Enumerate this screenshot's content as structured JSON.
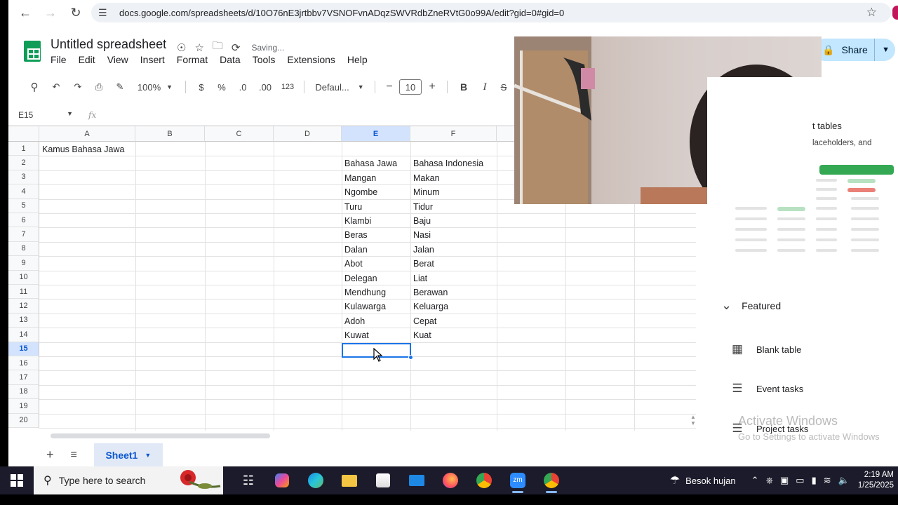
{
  "browser": {
    "url": "docs.google.com/spreadsheets/d/10O76nE3jrtbbv7VSNOFvnADqzSWVRdbZneRVtG0o99A/edit?gid=0#gid=0"
  },
  "sheets": {
    "title": "Untitled spreadsheet",
    "status": "Saving...",
    "menu": [
      "File",
      "Edit",
      "View",
      "Insert",
      "Format",
      "Data",
      "Tools",
      "Extensions",
      "Help"
    ],
    "toolbar": {
      "zoom": "100%",
      "currency": "$",
      "percent": "%",
      "dec_decrease": ".0",
      "dec_increase": ".00",
      "number_format": "123",
      "font": "Defaul...",
      "font_size": "10",
      "bold": "B",
      "italic": "I"
    },
    "share_label": "Share",
    "name_box": "E15",
    "fx": "fx",
    "columns": [
      "A",
      "B",
      "C",
      "D",
      "E",
      "F"
    ],
    "rows": [
      "1",
      "2",
      "3",
      "4",
      "5",
      "6",
      "7",
      "8",
      "9",
      "10",
      "11",
      "12",
      "13",
      "14",
      "15",
      "16",
      "17",
      "18",
      "19",
      "20"
    ],
    "cells": {
      "a1": "Kamus Bahasa Jawa",
      "header_e": "Bahasa Jawa",
      "header_f": "Bahasa Indonesia",
      "jawa": [
        "Mangan",
        "Ngombe",
        "Turu",
        "Klambi",
        "Beras",
        "Dalan",
        "Abot",
        "Delegan",
        "Mendhung",
        "Kulawarga",
        "Adoh",
        "Kuwat"
      ],
      "indonesia": [
        "Makan",
        "Minum",
        "Tidur",
        "Baju",
        "Nasi",
        "Jalan",
        "Berat",
        "Liat",
        "Berawan",
        "Keluarga",
        "Cepat",
        "Kuat"
      ]
    },
    "sheet_tab": "Sheet1"
  },
  "side_panel": {
    "title_fragment": "t tables",
    "subtitle_fragment": "laceholders, and",
    "featured": "Featured",
    "items": [
      "Blank table",
      "Event tasks",
      "Project tasks"
    ]
  },
  "watermark": {
    "line1": "Activate Windows",
    "line2": "Go to Settings to activate Windows"
  },
  "taskbar": {
    "search_placeholder": "Type here to search",
    "weather": "Besok hujan",
    "time": "2:19 AM",
    "date": "1/25/2025"
  }
}
